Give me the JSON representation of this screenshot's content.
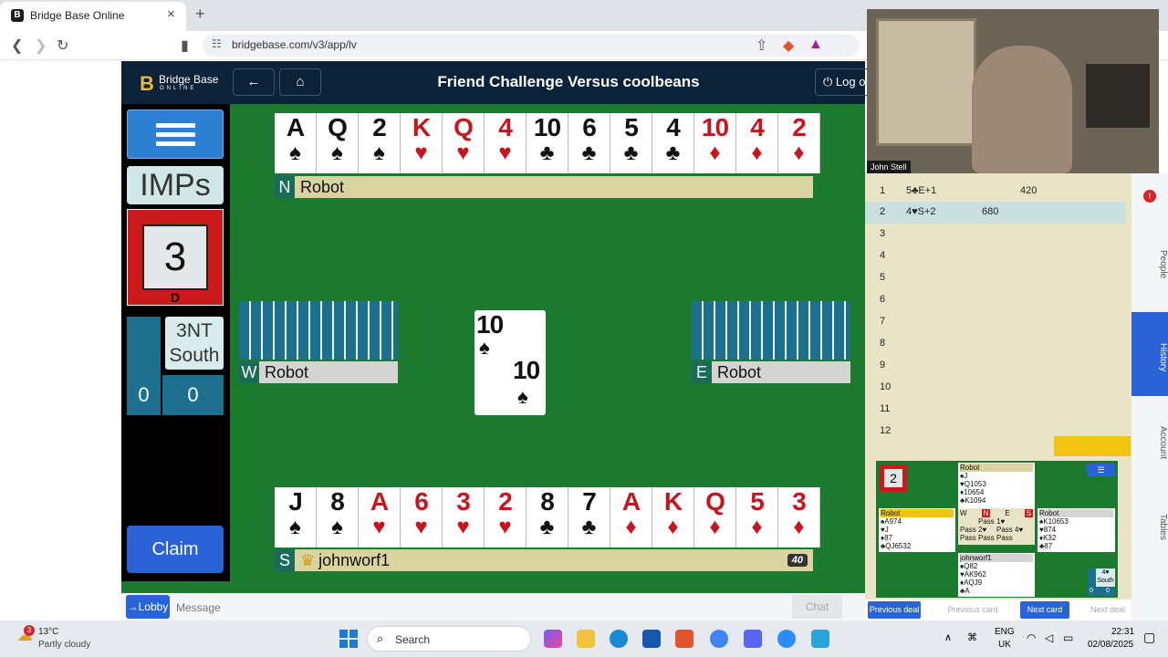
{
  "browser": {
    "tab_title": "Bridge Base Online",
    "tab_close": "×",
    "new_tab": "+",
    "url": "bridgebase.com/v3/app/lv"
  },
  "header": {
    "logo_main": "Bridge Base",
    "logo_sub": "ONLINE",
    "title": "Friend Challenge Versus coolbeans",
    "logout": "Log out"
  },
  "left": {
    "scoring": "IMPs",
    "board_number": "3",
    "dealer": "D",
    "contract": "3NT",
    "declarer": "South",
    "tricks_ns": "0",
    "tricks_ew": "0",
    "claim": "Claim"
  },
  "north": {
    "dir": "N",
    "name": "Robot",
    "cards": [
      {
        "r": "A",
        "s": "♠",
        "c": "blk"
      },
      {
        "r": "Q",
        "s": "♠",
        "c": "blk"
      },
      {
        "r": "2",
        "s": "♠",
        "c": "blk"
      },
      {
        "r": "K",
        "s": "♥",
        "c": "red"
      },
      {
        "r": "Q",
        "s": "♥",
        "c": "red"
      },
      {
        "r": "4",
        "s": "♥",
        "c": "red"
      },
      {
        "r": "10",
        "s": "♣",
        "c": "blk"
      },
      {
        "r": "6",
        "s": "♣",
        "c": "blk"
      },
      {
        "r": "5",
        "s": "♣",
        "c": "blk"
      },
      {
        "r": "4",
        "s": "♣",
        "c": "blk"
      },
      {
        "r": "10",
        "s": "♦",
        "c": "red"
      },
      {
        "r": "4",
        "s": "♦",
        "c": "red"
      },
      {
        "r": "2",
        "s": "♦",
        "c": "red"
      }
    ]
  },
  "south": {
    "dir": "S",
    "name": "johnworf1",
    "badge": "40",
    "cards": [
      {
        "r": "J",
        "s": "♠",
        "c": "blk"
      },
      {
        "r": "8",
        "s": "♠",
        "c": "blk"
      },
      {
        "r": "A",
        "s": "♥",
        "c": "red"
      },
      {
        "r": "6",
        "s": "♥",
        "c": "red"
      },
      {
        "r": "3",
        "s": "♥",
        "c": "red"
      },
      {
        "r": "2",
        "s": "♥",
        "c": "red"
      },
      {
        "r": "8",
        "s": "♣",
        "c": "blk"
      },
      {
        "r": "7",
        "s": "♣",
        "c": "blk"
      },
      {
        "r": "A",
        "s": "♦",
        "c": "red"
      },
      {
        "r": "K",
        "s": "♦",
        "c": "red"
      },
      {
        "r": "Q",
        "s": "♦",
        "c": "red"
      },
      {
        "r": "5",
        "s": "♦",
        "c": "red"
      },
      {
        "r": "3",
        "s": "♦",
        "c": "red"
      }
    ]
  },
  "west": {
    "dir": "W",
    "name": "Robot"
  },
  "east": {
    "dir": "E",
    "name": "Robot"
  },
  "played": {
    "rank": "10",
    "suit": "♠"
  },
  "chat": {
    "lobby": "→Lobby",
    "placeholder": "Message",
    "button": "Chat"
  },
  "video": {
    "name": "John Stell"
  },
  "history": {
    "rows": [
      {
        "n": "1",
        "c": "5♣E+1",
        "ns": "",
        "ew": "420"
      },
      {
        "n": "2",
        "c": "4♥S+2",
        "ns": "680",
        "ew": ""
      },
      {
        "n": "3"
      },
      {
        "n": "4"
      },
      {
        "n": "5"
      },
      {
        "n": "6"
      },
      {
        "n": "7"
      },
      {
        "n": "8"
      },
      {
        "n": "9"
      },
      {
        "n": "10"
      },
      {
        "n": "11"
      },
      {
        "n": "12"
      }
    ]
  },
  "mini": {
    "board": "2",
    "north": [
      "Robot",
      "♠J",
      "♥Q1053",
      "♦10654",
      "♣K1094"
    ],
    "west": [
      "Robot",
      "♠A974",
      "♥J",
      "♦87",
      "♣QJ6532"
    ],
    "east": [
      "Robot",
      "♠K10653",
      "♥874",
      "♦K32",
      "♣87"
    ],
    "south": [
      "johnworf1",
      "♠Q82",
      "♥AK962",
      "♦AQJ9",
      "♣A"
    ],
    "auction_head": [
      "W",
      "N",
      "E",
      "S"
    ],
    "auction": [
      "",
      "Pass",
      "1♥",
      "",
      "Pass",
      "2♥",
      "Pass",
      "4♥",
      "Pass",
      "Pass",
      "Pass",
      ""
    ],
    "contract": "4♥",
    "declarer": "South",
    "score_ns": "0",
    "score_ew": "0"
  },
  "nav": {
    "prev_deal": "Previous deal",
    "prev_card": "Previous card",
    "next_card": "Next card",
    "next_deal": "Next deal"
  },
  "sidetabs": [
    "People",
    "History",
    "Account",
    "Tables"
  ],
  "taskbar": {
    "temp": "13°C",
    "weather": "Partly cloudy",
    "search": "Search",
    "lang1": "ENG",
    "lang2": "UK",
    "time": "22:31",
    "date": "02/08/2025",
    "weather_badge": "3"
  }
}
